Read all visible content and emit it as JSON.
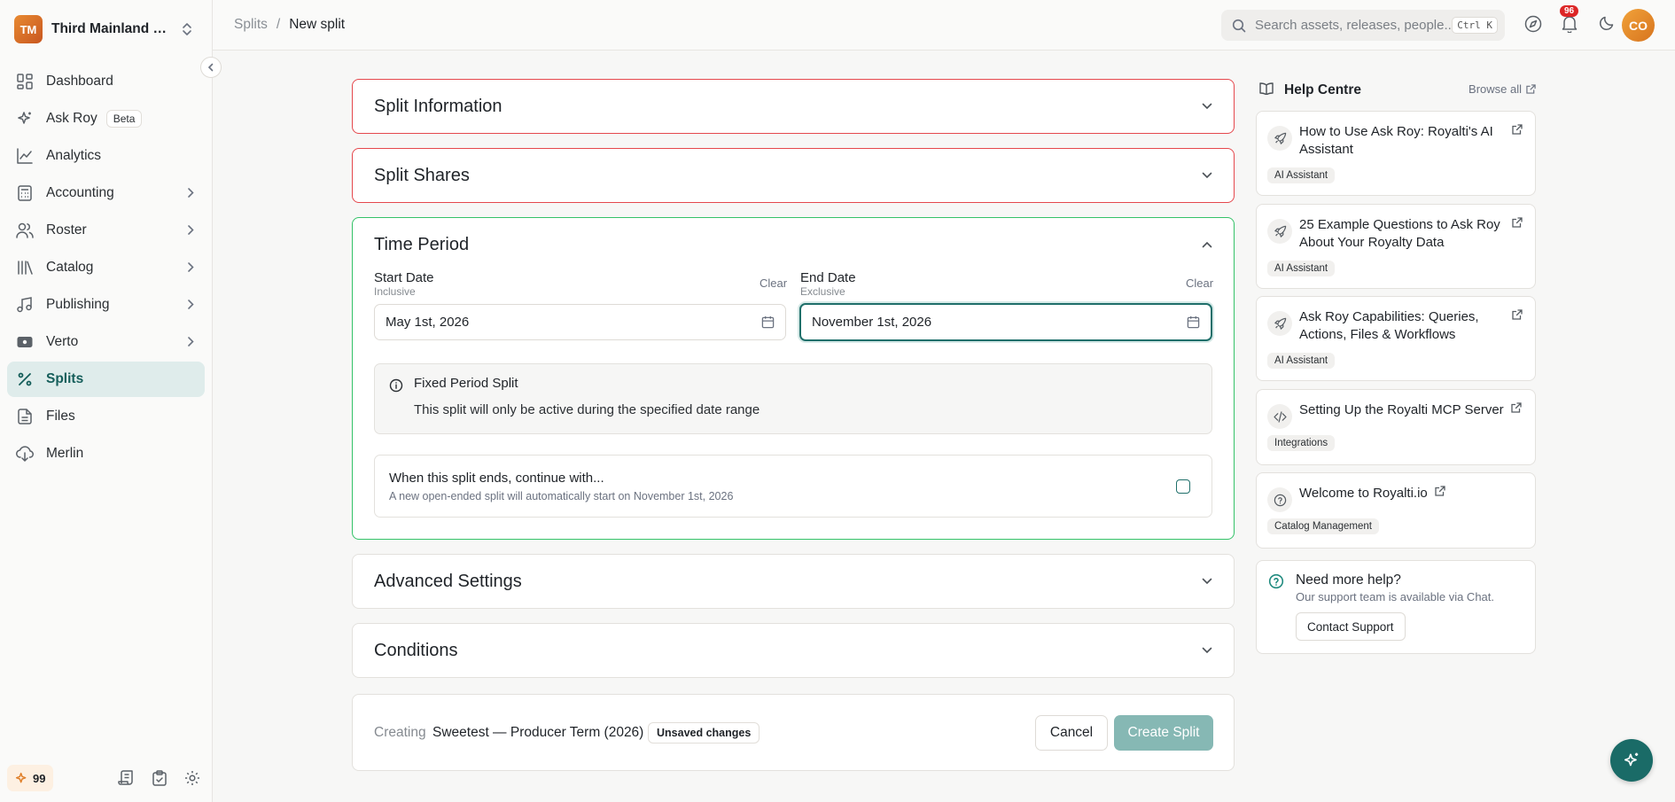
{
  "sidebar": {
    "org_initials": "TM",
    "org_name": "Third Mainland Records",
    "items": [
      {
        "label": "Dashboard"
      },
      {
        "label": "Ask Roy",
        "badge": "Beta"
      },
      {
        "label": "Analytics"
      },
      {
        "label": "Accounting"
      },
      {
        "label": "Roster"
      },
      {
        "label": "Catalog"
      },
      {
        "label": "Publishing"
      },
      {
        "label": "Verto"
      },
      {
        "label": "Splits"
      },
      {
        "label": "Files"
      },
      {
        "label": "Merlin"
      }
    ],
    "credits": "99"
  },
  "topbar": {
    "breadcrumb_parent": "Splits",
    "breadcrumb_sep": "/",
    "breadcrumb_current": "New split",
    "search_placeholder": "Search assets, releases, people...",
    "search_shortcut": "Ctrl K",
    "notification_count": "96",
    "user_initials": "CO"
  },
  "sections": {
    "split_information": "Split Information",
    "split_shares": "Split Shares",
    "time_period": "Time Period",
    "advanced_settings": "Advanced Settings",
    "conditions": "Conditions"
  },
  "time_period": {
    "start_label": "Start Date",
    "start_sub": "Inclusive",
    "start_value": "May 1st, 2026",
    "end_label": "End Date",
    "end_sub": "Exclusive",
    "end_value": "November 1st, 2026",
    "clear": "Clear",
    "info_title": "Fixed Period Split",
    "info_text": "This split will only be active during the specified date range",
    "continue_title": "When this split ends, continue with...",
    "continue_sub": "A new open-ended split will automatically start on November 1st, 2026",
    "continue_checked": false
  },
  "footer": {
    "creating_label": "Creating",
    "split_name": "Sweetest — Producer Term (2026)",
    "unsaved": "Unsaved changes",
    "cancel": "Cancel",
    "create": "Create Split"
  },
  "help": {
    "title": "Help Centre",
    "browse": "Browse all",
    "articles": [
      {
        "title": "How to Use Ask Roy: Royalti's AI Assistant",
        "tag": "AI Assistant",
        "icon": "rocket-icon"
      },
      {
        "title": "25 Example Questions to Ask Roy About Your Royalty Data",
        "tag": "AI Assistant",
        "icon": "rocket-icon"
      },
      {
        "title": "Ask Roy Capabilities: Queries, Actions, Files & Workflows",
        "tag": "AI Assistant",
        "icon": "rocket-icon"
      },
      {
        "title": "Setting Up the Royalti MCP Server",
        "tag": "Integrations",
        "icon": "code-icon"
      },
      {
        "title": "Welcome to Royalti.io",
        "tag": "Catalog Management",
        "icon": "question-icon"
      }
    ],
    "support_title": "Need more help?",
    "support_sub": "Our support team is available via Chat.",
    "support_button": "Contact Support"
  },
  "colors": {
    "accent": "#1a6b67",
    "error_border": "#e5484d",
    "success_border": "#34c268",
    "active_nav_bg": "#dfeceb"
  }
}
